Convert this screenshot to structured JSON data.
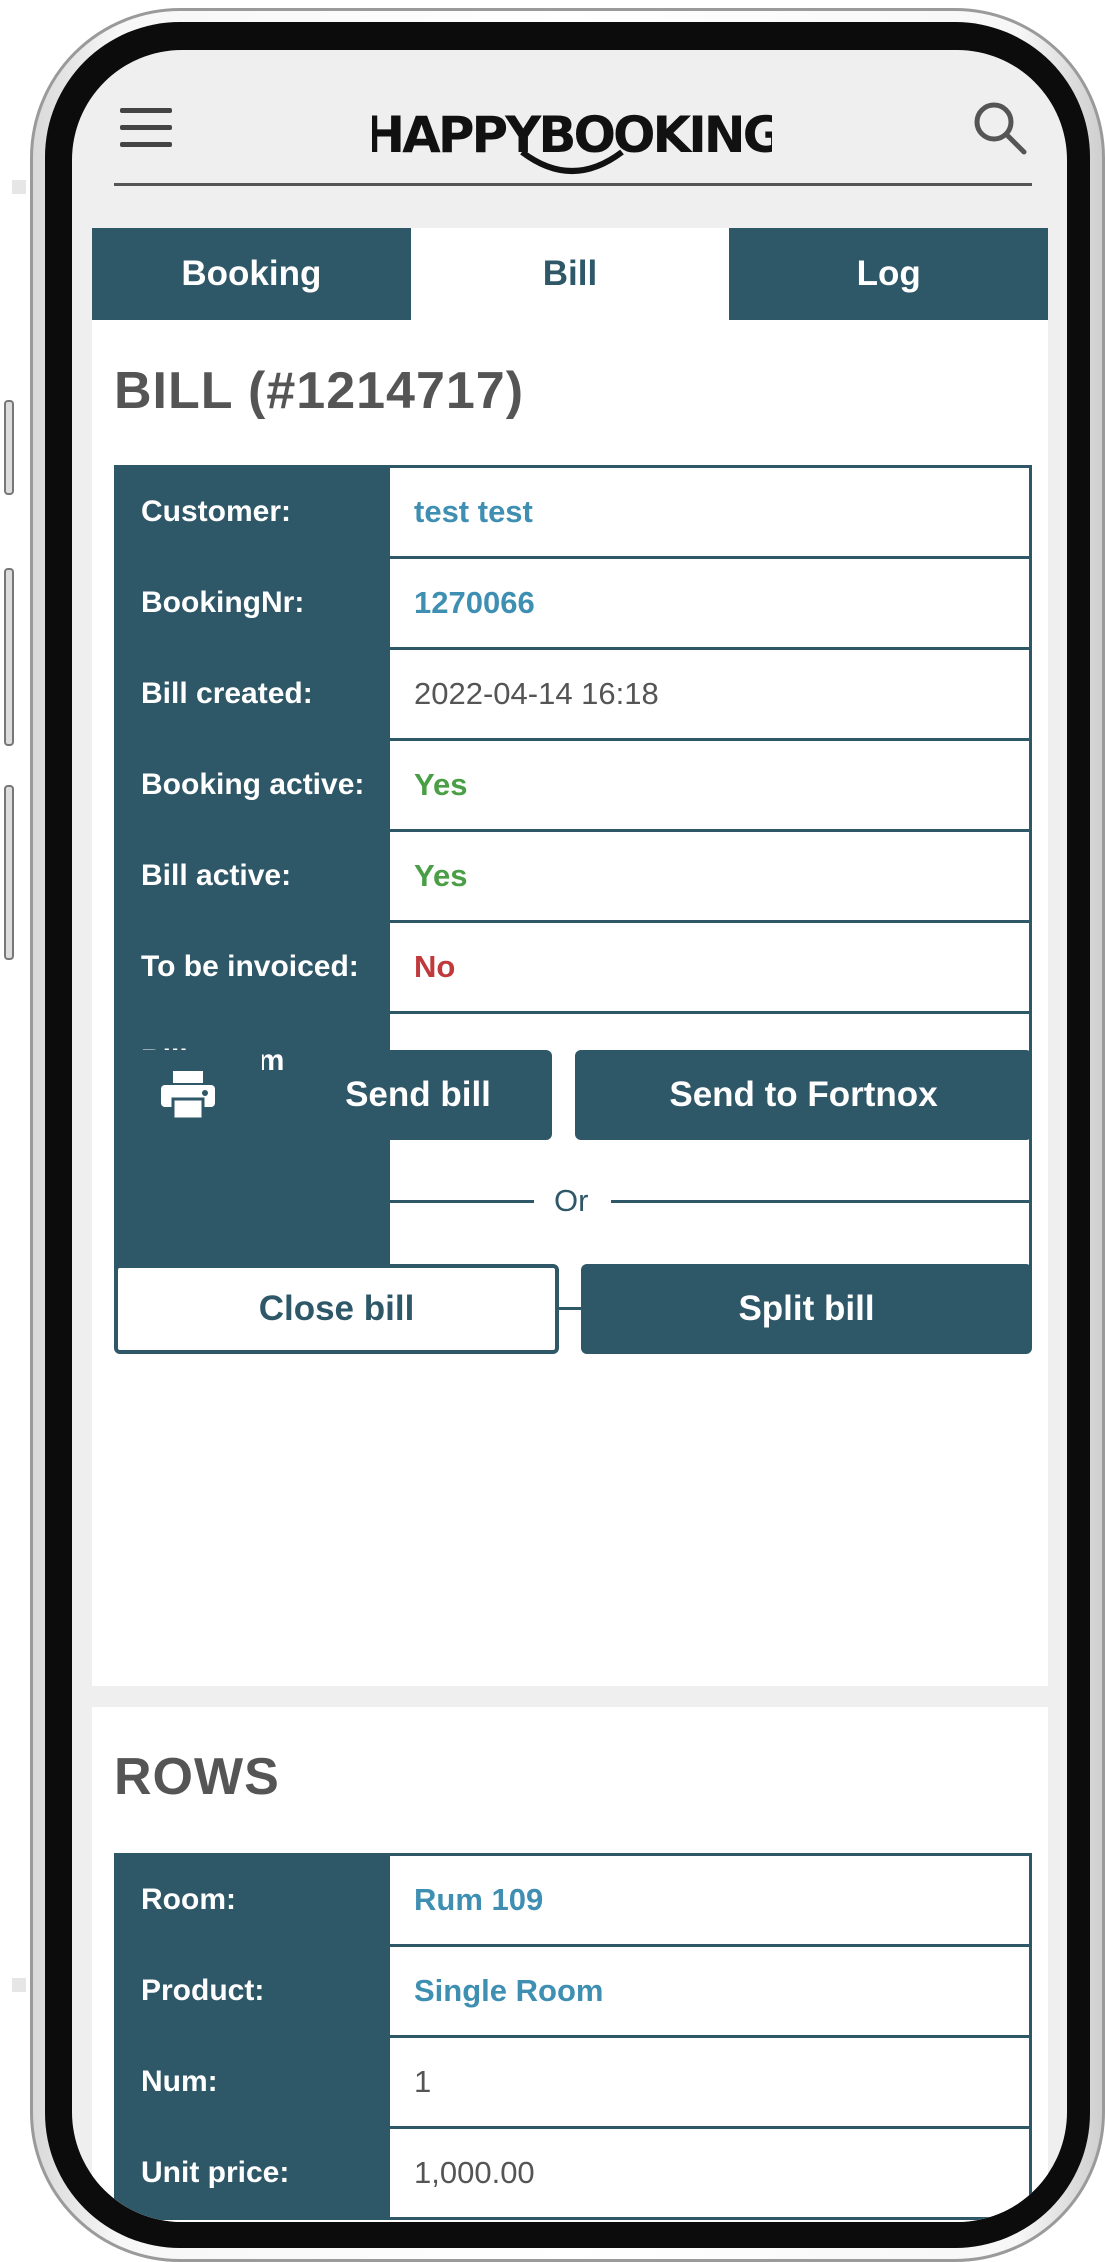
{
  "header": {
    "logo_text": "HAPPYBOOKING"
  },
  "tabs": [
    {
      "label": "Booking"
    },
    {
      "label": "Bill"
    },
    {
      "label": "Log"
    }
  ],
  "bill": {
    "title": "BILL (#1214717)",
    "rows": [
      {
        "label": "Customer:",
        "value": "test test"
      },
      {
        "label": "BookingNr:",
        "value": "1270066"
      },
      {
        "label": "Bill created:",
        "value": "2022-04-14 16:18"
      },
      {
        "label": "Booking active:",
        "value": "Yes"
      },
      {
        "label": "Bill active:",
        "value": "Yes"
      },
      {
        "label": "To be invoiced:",
        "value": "No"
      },
      {
        "label": "Bill comment:",
        "value": ""
      }
    ],
    "buttons": {
      "print_icon": "printer-icon",
      "send_bill": "Send bill",
      "send_to_fortnox": "Send to Fortnox",
      "or": "Or",
      "close_bill": "Close bill",
      "split_bill": "Split bill"
    }
  },
  "rows_section": {
    "title": "ROWS",
    "rows": [
      {
        "label": "Room:",
        "value": "Rum 109"
      },
      {
        "label": "Product:",
        "value": "Single Room"
      },
      {
        "label": "Num:",
        "value": "1"
      },
      {
        "label": "Unit price:",
        "value": "1,000.00"
      }
    ]
  },
  "colors": {
    "primary": "#2e5768",
    "link": "#3f8fb3",
    "yes": "#4a9f46",
    "no": "#c0393b"
  }
}
